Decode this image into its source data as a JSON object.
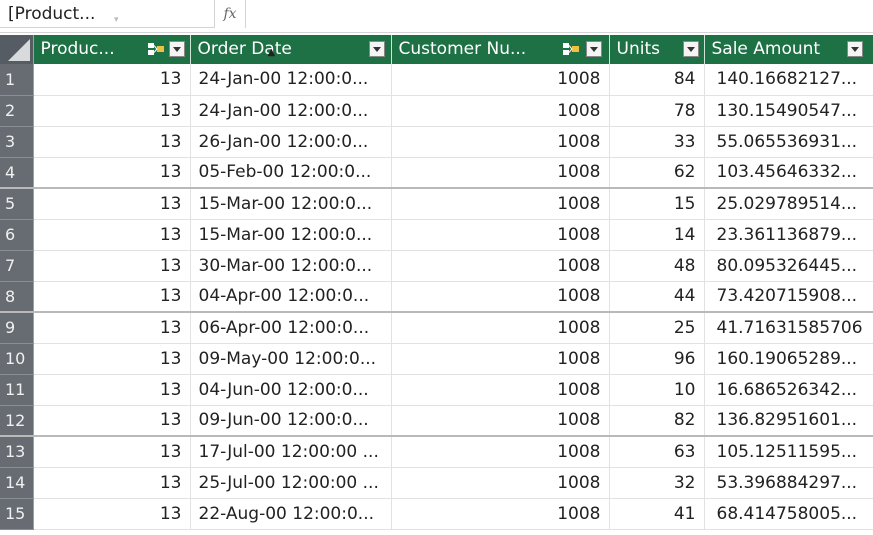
{
  "formula_bar": {
    "name_box": "[Product...",
    "fx_label": "fx"
  },
  "columns": [
    {
      "label": "Produc...",
      "has_relationship_icon": true
    },
    {
      "label": "Order Date",
      "has_relationship_icon": false
    },
    {
      "label": "Customer Nu...",
      "has_relationship_icon": true
    },
    {
      "label": "Units",
      "has_relationship_icon": false
    },
    {
      "label": "Sale Amount",
      "has_relationship_icon": false
    }
  ],
  "rows": [
    {
      "n": "1",
      "product": "13",
      "date": "24-Jan-00 12:00:0...",
      "customer": "1008",
      "units": "84",
      "amount": "140.16682127..."
    },
    {
      "n": "2",
      "product": "13",
      "date": "24-Jan-00 12:00:0...",
      "customer": "1008",
      "units": "78",
      "amount": "130.15490547..."
    },
    {
      "n": "3",
      "product": "13",
      "date": "26-Jan-00 12:00:0...",
      "customer": "1008",
      "units": "33",
      "amount": "55.065536931..."
    },
    {
      "n": "4",
      "product": "13",
      "date": "05-Feb-00 12:00:0...",
      "customer": "1008",
      "units": "62",
      "amount": "103.45646332..."
    },
    {
      "n": "5",
      "product": "13",
      "date": "15-Mar-00 12:00:0...",
      "customer": "1008",
      "units": "15",
      "amount": "25.029789514..."
    },
    {
      "n": "6",
      "product": "13",
      "date": "15-Mar-00 12:00:0...",
      "customer": "1008",
      "units": "14",
      "amount": "23.361136879..."
    },
    {
      "n": "7",
      "product": "13",
      "date": "30-Mar-00 12:00:0...",
      "customer": "1008",
      "units": "48",
      "amount": "80.095326445..."
    },
    {
      "n": "8",
      "product": "13",
      "date": "04-Apr-00 12:00:0...",
      "customer": "1008",
      "units": "44",
      "amount": "73.420715908..."
    },
    {
      "n": "9",
      "product": "13",
      "date": "06-Apr-00 12:00:0...",
      "customer": "1008",
      "units": "25",
      "amount": "41.71631585706"
    },
    {
      "n": "10",
      "product": "13",
      "date": "09-May-00 12:00:0...",
      "customer": "1008",
      "units": "96",
      "amount": "160.19065289..."
    },
    {
      "n": "11",
      "product": "13",
      "date": "04-Jun-00 12:00:0...",
      "customer": "1008",
      "units": "10",
      "amount": "16.686526342..."
    },
    {
      "n": "12",
      "product": "13",
      "date": "09-Jun-00 12:00:0...",
      "customer": "1008",
      "units": "82",
      "amount": "136.82951601..."
    },
    {
      "n": "13",
      "product": "13",
      "date": "17-Jul-00 12:00:00 ...",
      "customer": "1008",
      "units": "63",
      "amount": "105.12511595..."
    },
    {
      "n": "14",
      "product": "13",
      "date": "25-Jul-00 12:00:00 ...",
      "customer": "1008",
      "units": "32",
      "amount": "53.396884297..."
    },
    {
      "n": "15",
      "product": "13",
      "date": "22-Aug-00 12:00:0...",
      "customer": "1008",
      "units": "41",
      "amount": "68.414758005..."
    }
  ],
  "colors": {
    "header_bg": "#1e7145",
    "header_text": "#ffffff",
    "rownum_bg": "#666c72"
  }
}
